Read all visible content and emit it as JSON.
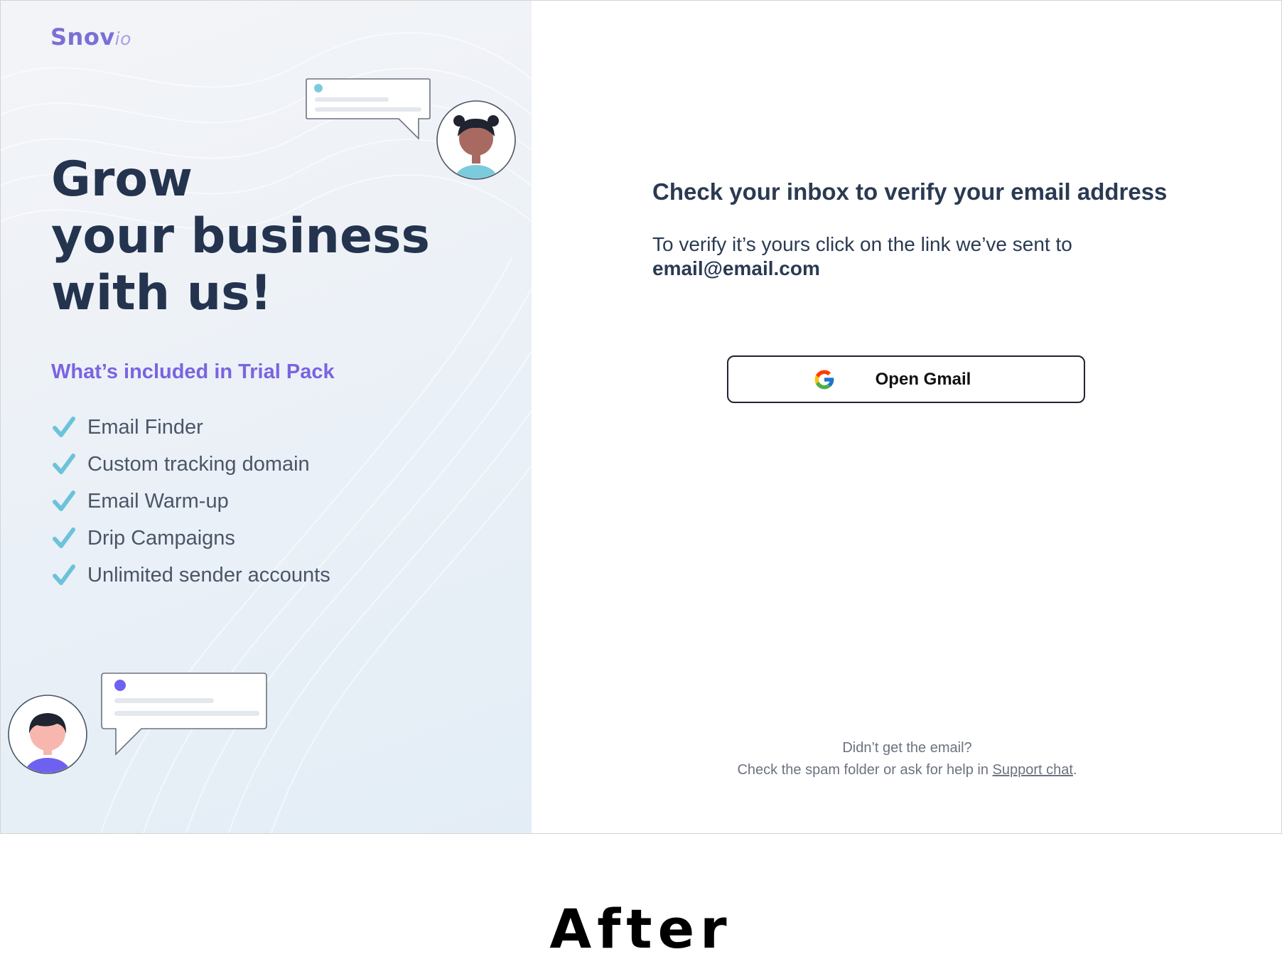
{
  "logo": {
    "brand": "Snov",
    "suffix": "io"
  },
  "left": {
    "headline": [
      "Grow",
      "your business",
      "with us!"
    ],
    "trial_title": "What’s included in Trial Pack",
    "features": [
      "Email Finder",
      "Custom tracking domain",
      "Email Warm-up",
      "Drip Campaigns",
      "Unlimited sender accounts"
    ]
  },
  "right": {
    "title": "Check your inbox to verify your email address",
    "description": "To verify it’s yours click on the link we’ve sent to",
    "email": "email@email.com",
    "gmail_button": "Open Gmail",
    "footer_line1": "Didn’t get the email?",
    "footer_line2": "Check the spam folder or ask for help in",
    "support_link": "Support chat",
    "footer_end": "."
  },
  "caption": "After",
  "colors": {
    "accent": "#7a64e0",
    "check": "#6cc3d9",
    "heading": "#24344f"
  },
  "icons": [
    "check-icon",
    "google-icon",
    "avatar-woman",
    "avatar-man",
    "chat-bubble"
  ]
}
